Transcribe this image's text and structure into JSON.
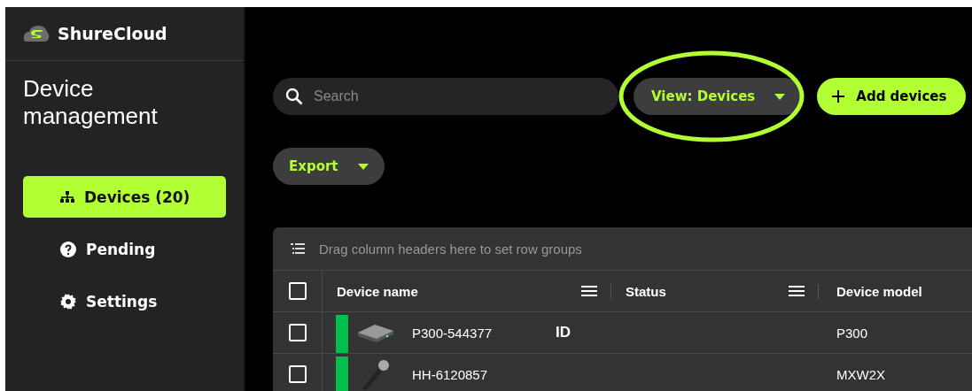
{
  "sidebar": {
    "brand": "ShureCloud",
    "title": "Device management",
    "items": [
      {
        "label": "Devices (20)",
        "kind": "tree",
        "selected": true
      },
      {
        "label": "Pending",
        "kind": "question",
        "selected": false
      },
      {
        "label": "Settings",
        "kind": "gear",
        "selected": false
      }
    ]
  },
  "toolbar": {
    "search": {
      "placeholder": "Search"
    },
    "view_button": "View: Devices",
    "view_highlighted": true,
    "add_button": "Add devices",
    "export_button": "Export"
  },
  "table": {
    "group_hint": "Drag column headers here to set row groups",
    "header_checked": false,
    "columns": [
      "Device name",
      "Status",
      "Device model"
    ],
    "rows": [
      {
        "checked": false,
        "color": "#00c04b",
        "kind": "receiver",
        "name": "P300-544377",
        "badge": "ID",
        "model": "P300"
      },
      {
        "checked": false,
        "color": "#00c04b",
        "kind": "microphone",
        "name": "HH-6120857",
        "badge": "",
        "model": "MXW2X"
      }
    ]
  }
}
